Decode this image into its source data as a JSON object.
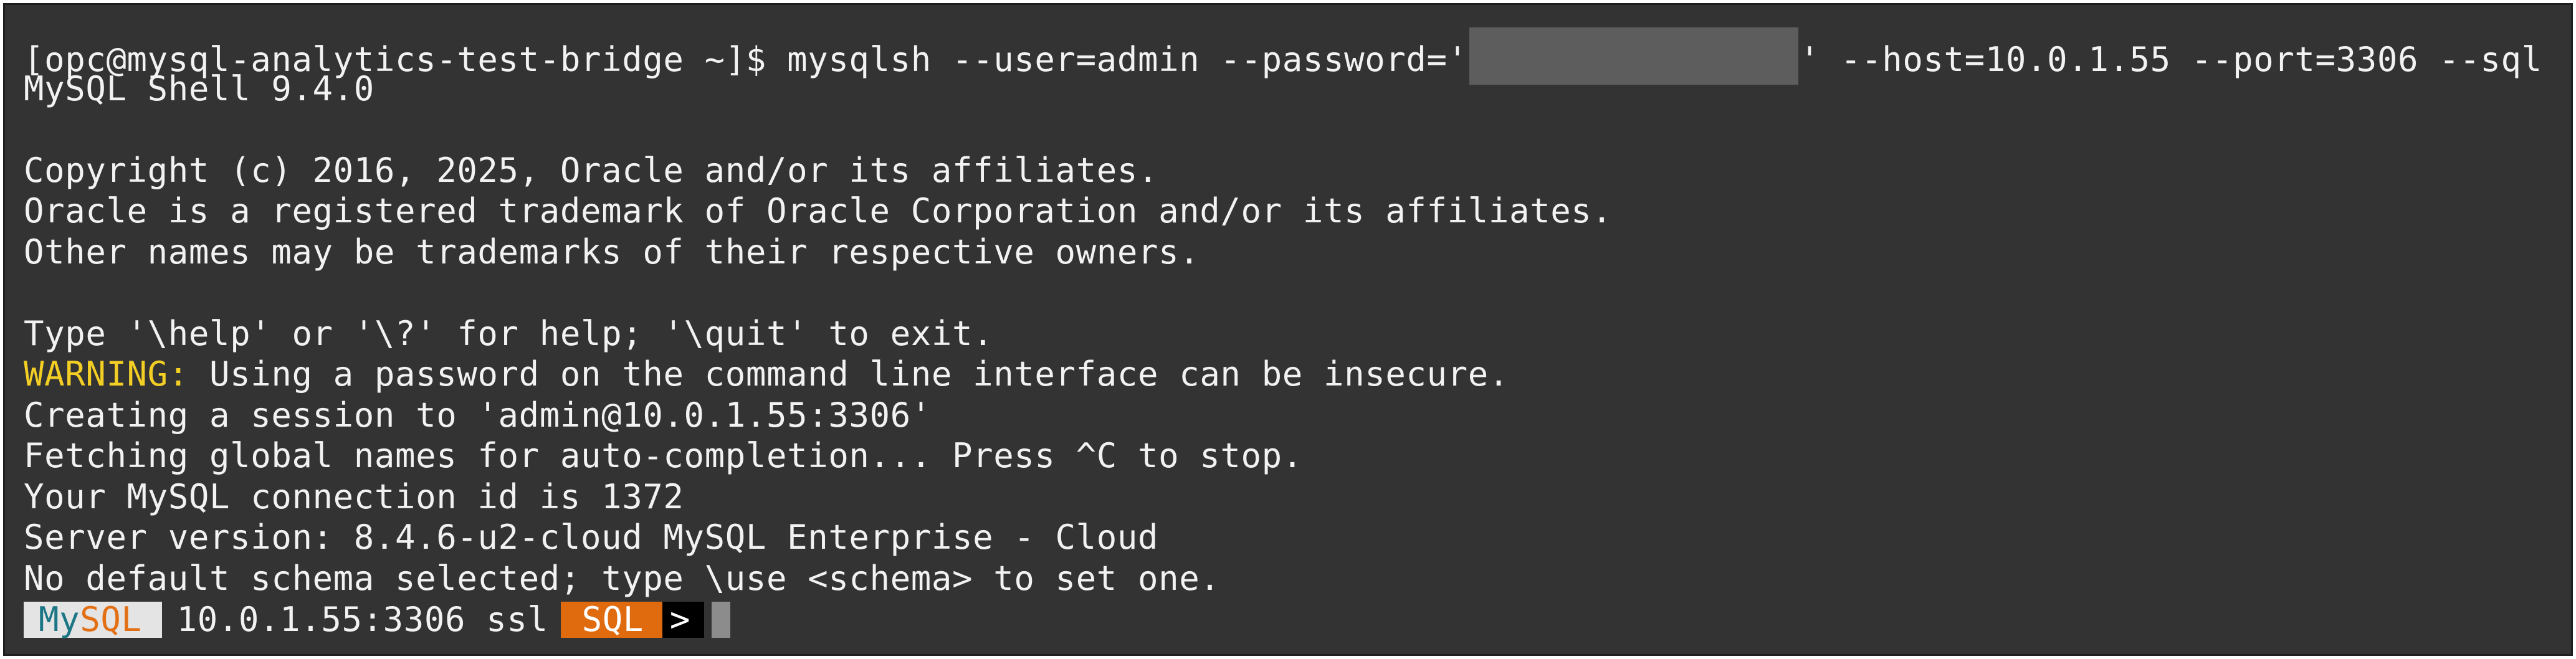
{
  "terminal": {
    "command_prefix": "[opc@mysql-analytics-test-bridge ~]$ mysqlsh --user=admin --password='",
    "command_suffix": "' --host=10.0.1.55 --port=3306 --sql",
    "shell_version": "MySQL Shell 9.4.0",
    "copyright": "Copyright (c) 2016, 2025, Oracle and/or its affiliates.",
    "trademark_1": "Oracle is a registered trademark of Oracle Corporation and/or its affiliates.",
    "trademark_2": "Other names may be trademarks of their respective owners.",
    "help_hint": "Type '\\help' or '\\?' for help; '\\quit' to exit.",
    "warning_label": "WARNING:",
    "warning_text": " Using a password on the command line interface can be insecure.",
    "session_line": "Creating a session to 'admin@10.0.1.55:3306'",
    "fetching_line": "Fetching global names for auto-completion... Press ^C to stop.",
    "connection_id_line": "Your MySQL connection id is 1372",
    "server_version_line": "Server version: 8.4.6-u2-cloud MySQL Enterprise - Cloud",
    "schema_line": "No default schema selected; type \\use <schema> to set one."
  },
  "prompt": {
    "brand_my": "My",
    "brand_sql": "SQL",
    "host_info": "10.0.1.55:3306 ssl",
    "mode": "SQL",
    "arrow": ">"
  },
  "colors": {
    "background": "#333333",
    "text": "#f2f2f2",
    "warning": "#f3ce24",
    "mysql_blue": "#1d7685",
    "mysql_orange": "#e26f14",
    "sql_mode_bg": "#e06b0f"
  }
}
